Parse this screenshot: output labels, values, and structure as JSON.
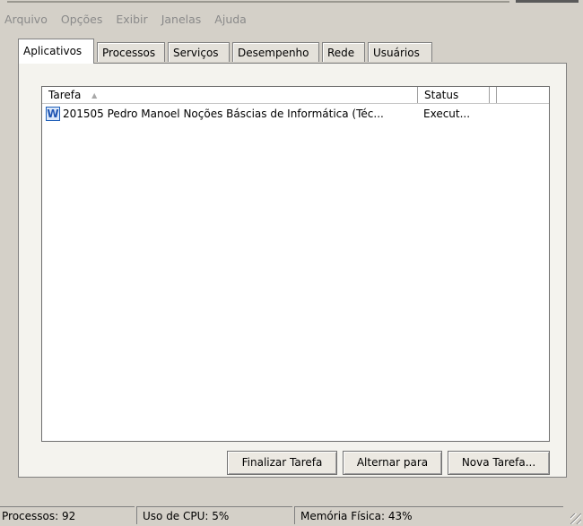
{
  "menu": [
    "Arquivo",
    "Opções",
    "Exibir",
    "Janelas",
    "Ajuda"
  ],
  "tabs": [
    "Aplicativos",
    "Processos",
    "Serviços",
    "Desempenho",
    "Rede",
    "Usuários"
  ],
  "active_tab": "Aplicativos",
  "list": {
    "columns": {
      "task": "Tarefa",
      "status": "Status"
    },
    "sort": {
      "column": "Tarefa",
      "direction": "ascending"
    },
    "rows": [
      {
        "icon": "word-document-icon",
        "icon_glyph": "W",
        "name": "201505 Pedro Manoel Noções Báscias de Informática (Téc...",
        "status": "Execut..."
      }
    ]
  },
  "buttons": {
    "end_task": "Finalizar Tarefa",
    "switch_to": "Alternar para",
    "new_task": "Nova Tarefa..."
  },
  "statusbar": {
    "processes": "Processos: 92",
    "cpu": "Uso de CPU: 5%",
    "memory": "Memória Física: 43%"
  },
  "colors": {
    "window_bg": "#d4d0c8",
    "menu_text_disabled": "#8a8a8a",
    "word_icon": "#1f55b3"
  }
}
